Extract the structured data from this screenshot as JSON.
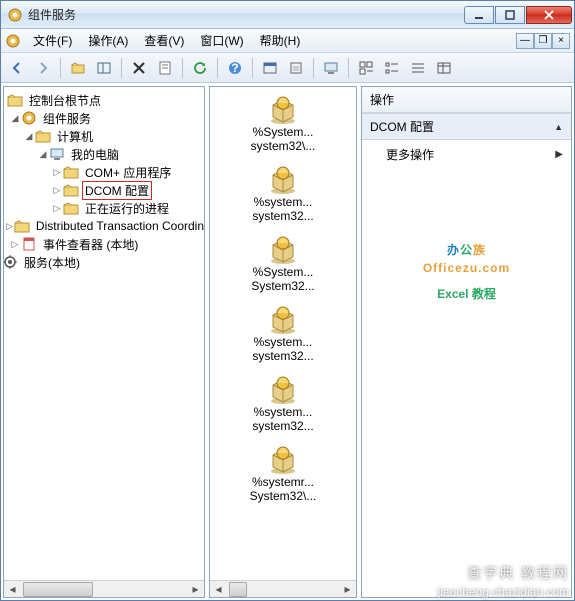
{
  "window": {
    "title": "组件服务"
  },
  "menu": {
    "items": [
      "文件(F)",
      "操作(A)",
      "查看(V)",
      "窗口(W)",
      "帮助(H)"
    ]
  },
  "tree": {
    "root": "控制台根节点",
    "n1": "组件服务",
    "n2": "计算机",
    "n3": "我的电脑",
    "n4": "COM+ 应用程序",
    "n5": "DCOM 配置",
    "n6": "正在运行的进程",
    "n7": "Distributed Transaction Coordinator",
    "n8": "事件查看器 (本地)",
    "n9": "服务(本地)"
  },
  "list": {
    "items": [
      {
        "l1": "%System...",
        "l2": "system32\\..."
      },
      {
        "l1": "%system...",
        "l2": "system32..."
      },
      {
        "l1": "%System...",
        "l2": "System32..."
      },
      {
        "l1": "%system...",
        "l2": "system32..."
      },
      {
        "l1": "%system...",
        "l2": "system32..."
      },
      {
        "l1": "%systemr...",
        "l2": "System32\\..."
      }
    ]
  },
  "actions": {
    "header": "操作",
    "section": "DCOM 配置",
    "more": "更多操作"
  },
  "watermark": {
    "brand": "办公族",
    "domain": "Officezu.com",
    "sub": "Excel 教程",
    "site1": "查字典 教程网",
    "site2": "jiaocheng.chazidian.com"
  }
}
